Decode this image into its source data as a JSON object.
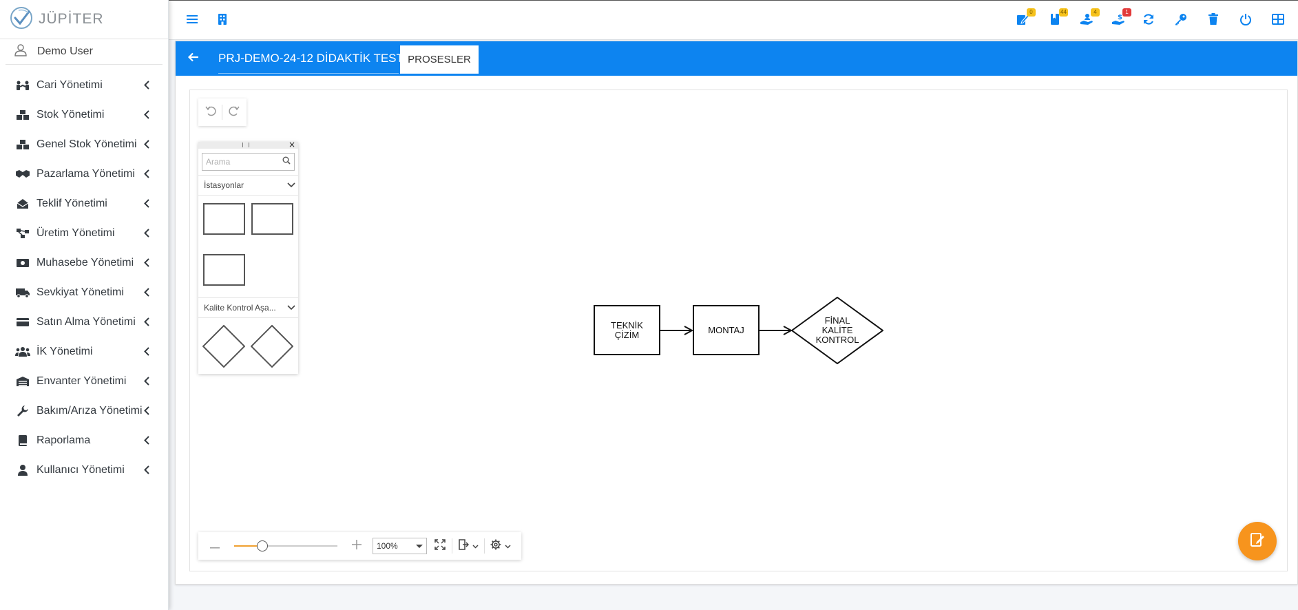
{
  "brand": {
    "name": "JÜPİTER",
    "icon": "jupiter-logo-icon"
  },
  "user": {
    "name": "Demo User",
    "icon": "user-icon"
  },
  "sidebar": {
    "items": [
      {
        "label": "Cari Yönetimi",
        "icon": "handshake-users-icon"
      },
      {
        "label": "Stok Yönetimi",
        "icon": "boxes-icon"
      },
      {
        "label": "Genel Stok Yönetimi",
        "icon": "boxes-icon"
      },
      {
        "label": "Pazarlama Yönetimi",
        "icon": "handshake-icon"
      },
      {
        "label": "Teklif Yönetimi",
        "icon": "envelope-open-icon"
      },
      {
        "label": "Üretim Yönetimi",
        "icon": "project-diagram-icon"
      },
      {
        "label": "Muhasebe Yönetimi",
        "icon": "money-bill-icon"
      },
      {
        "label": "Sevkiyat Yönetimi",
        "icon": "truck-icon"
      },
      {
        "label": "Satın Alma Yönetimi",
        "icon": "credit-card-icon"
      },
      {
        "label": "İK Yönetimi",
        "icon": "users-icon"
      },
      {
        "label": "Envanter Yönetimi",
        "icon": "warehouse-icon"
      },
      {
        "label": "Bakım/Arıza Yönetimi",
        "icon": "wrench-icon"
      },
      {
        "label": "Raporlama",
        "icon": "book-icon"
      },
      {
        "label": "Kullanıcı Yönetimi",
        "icon": "user-icon"
      }
    ]
  },
  "topbar": {
    "buttons": [
      {
        "icon": "hamburger-menu-icon"
      },
      {
        "icon": "building-icon"
      },
      {
        "icon": "edit-document-icon",
        "badge": "0"
      },
      {
        "icon": "book-bookmark-icon",
        "badge": "44"
      },
      {
        "icon": "hand-holding-user-icon",
        "badge": "4"
      },
      {
        "icon": "hand-holding-dollar-icon",
        "badge": "1"
      },
      {
        "icon": "sync-icon"
      },
      {
        "icon": "key-icon"
      },
      {
        "icon": "trash-icon"
      },
      {
        "icon": "power-icon"
      },
      {
        "icon": "table-grid-icon"
      }
    ],
    "colors": {
      "icon": "#0d84f0",
      "badge_yellow": "#f6c21c",
      "badge_red": "#e23a3a"
    }
  },
  "header": {
    "project_title": "PRJ-DEMO-24-12 DİDAKTİK TEST -",
    "tab_label": "PROSESLER",
    "accent_color": "#0d84f0"
  },
  "palette": {
    "search_placeholder": "Arama",
    "group1_label": "İstasyonlar",
    "group2_label": "Kalite Kontrol Aşa...",
    "close_symbol": "×"
  },
  "diagram": {
    "nodes": [
      {
        "id": "n1",
        "shape": "rectangle",
        "label_line1": "TEKNİK",
        "label_line2": "ÇİZİM"
      },
      {
        "id": "n2",
        "shape": "rectangle",
        "label_line1": "MONTAJ"
      },
      {
        "id": "n3",
        "shape": "diamond",
        "label_line1": "FİNAL",
        "label_line2": "KALİTE",
        "label_line3": "KONTROL"
      }
    ],
    "edges": [
      {
        "from": "n1",
        "to": "n2"
      },
      {
        "from": "n2",
        "to": "n3"
      }
    ]
  },
  "zoom": {
    "value": 0.27,
    "label": "100%"
  },
  "fab": {
    "icon": "edit-note-icon",
    "color": "#f7941d"
  }
}
